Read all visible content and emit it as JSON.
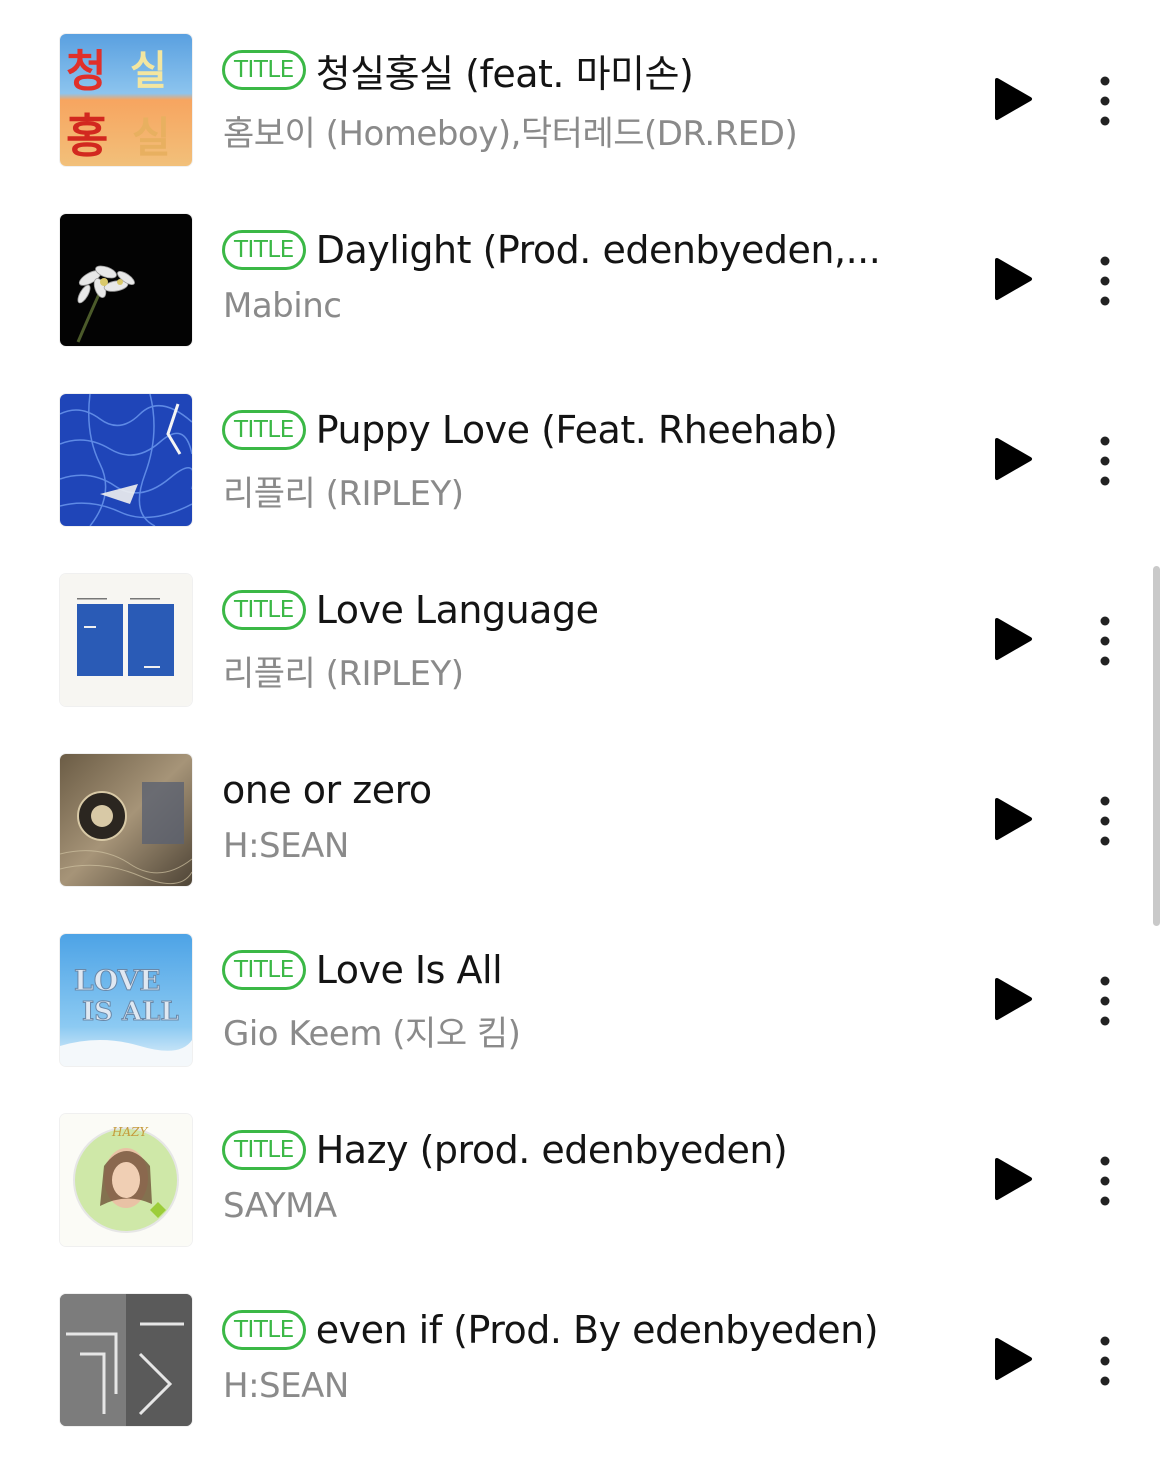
{
  "badge_label": "TITLE",
  "songs": [
    {
      "title": "청실홍실 (feat. 마미손)",
      "artist": "홈보이 (Homeboy),닥터레드(DR.RED)",
      "has_title_badge": true,
      "art": "album-art-cheongsil-hongsil"
    },
    {
      "title": "Daylight (Prod. edenbyeden,...",
      "artist": "Mabinc",
      "has_title_badge": true,
      "art": "album-art-daylight"
    },
    {
      "title": "Puppy Love (Feat. Rheehab)",
      "artist": "리플리 (RIPLEY)",
      "has_title_badge": true,
      "art": "album-art-puppy-love"
    },
    {
      "title": "Love Language",
      "artist": "리플리 (RIPLEY)",
      "has_title_badge": true,
      "art": "album-art-love-language"
    },
    {
      "title": "one or zero",
      "artist": "H:SEAN",
      "has_title_badge": false,
      "art": "album-art-one-or-zero"
    },
    {
      "title": "Love Is All",
      "artist": "Gio Keem (지오 킴)",
      "has_title_badge": true,
      "art": "album-art-love-is-all"
    },
    {
      "title": "Hazy (prod. edenbyeden)",
      "artist": "SAYMA",
      "has_title_badge": true,
      "art": "album-art-hazy"
    },
    {
      "title": "even if (Prod. By edenbyeden)",
      "artist": "H:SEAN",
      "has_title_badge": true,
      "art": "album-art-even-if"
    }
  ],
  "icons": {
    "play": "play-icon",
    "more": "more-vertical-icon"
  },
  "colors": {
    "badge_green": "#3bb846",
    "title_text": "#141414",
    "artist_text": "#8a8a8a"
  }
}
